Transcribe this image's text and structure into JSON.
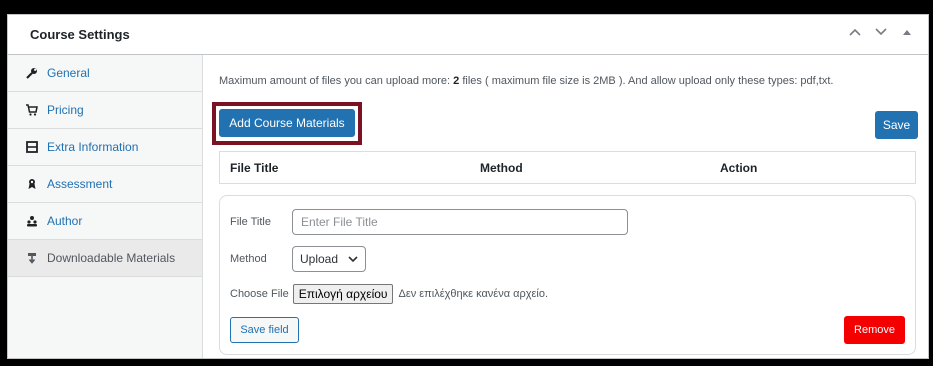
{
  "header": {
    "title": "Course Settings"
  },
  "sidebar": {
    "items": [
      {
        "label": "General",
        "icon": "wrench-icon"
      },
      {
        "label": "Pricing",
        "icon": "cart-icon"
      },
      {
        "label": "Extra Information",
        "icon": "panel-icon"
      },
      {
        "label": "Assessment",
        "icon": "award-icon"
      },
      {
        "label": "Author",
        "icon": "users-icon"
      },
      {
        "label": "Downloadable Materials",
        "icon": "download-icon",
        "active": true
      }
    ]
  },
  "main": {
    "info_prefix": "Maximum amount of files you can upload more: ",
    "info_count": "2",
    "info_suffix": " files ( maximum file size is 2MB ). And allow upload only these types: pdf,txt.",
    "add_button": "Add Course Materials",
    "save_button": "Save",
    "table_headers": [
      "File Title",
      "Method",
      "Action"
    ],
    "form": {
      "file_title_label": "File Title",
      "file_title_placeholder": "Enter File Title",
      "method_label": "Method",
      "method_value": "Upload",
      "choose_file_label": "Choose File",
      "file_button": "Επιλογή αρχείου",
      "no_file_text": "Δεν επιλέχθηκε κανένα αρχείο.",
      "save_field": "Save field",
      "remove": "Remove"
    }
  },
  "colors": {
    "primary": "#2271b1",
    "danger": "#f40000",
    "highlight": "#7a1224"
  }
}
